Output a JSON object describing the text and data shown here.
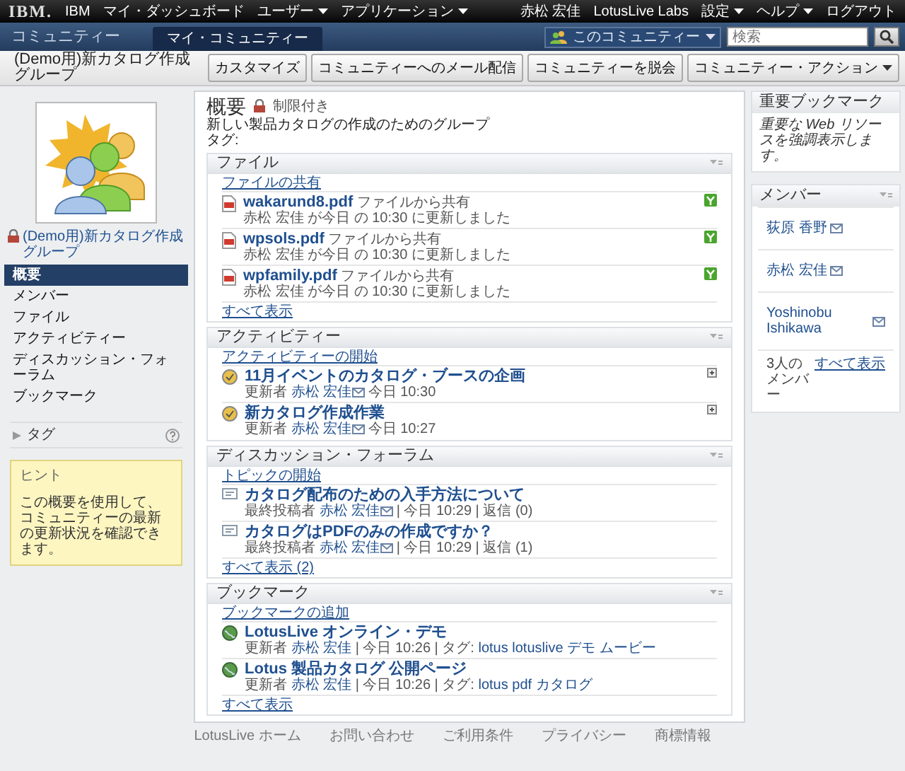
{
  "top_bar": {
    "logo": "IBM.",
    "left_items": [
      {
        "label": "IBM",
        "has_menu": false
      },
      {
        "label": "マイ・ダッシュボード",
        "has_menu": false
      },
      {
        "label": "ユーザー",
        "has_menu": true
      },
      {
        "label": "アプリケーション",
        "has_menu": true
      }
    ],
    "right_items": [
      {
        "label": "赤松 宏佳",
        "has_menu": false
      },
      {
        "label": "LotusLive Labs",
        "has_menu": false
      },
      {
        "label": "設定",
        "has_menu": true
      },
      {
        "label": "ヘルプ",
        "has_menu": true
      },
      {
        "label": "ログアウト",
        "has_menu": false
      }
    ]
  },
  "nav_bar": {
    "title": "コミュニティー",
    "tabs": [
      {
        "label": "マイ・コミュニティー",
        "selected": true
      }
    ],
    "scope": "このコミュニティー",
    "search": {
      "placeholder": "検索"
    }
  },
  "title_bar": {
    "title": "(Demo用)新カタログ作成グループ",
    "buttons": [
      {
        "label": "カスタマイズ",
        "has_menu": false
      },
      {
        "label": "コミュニティーへのメール配信",
        "has_menu": false
      },
      {
        "label": "コミュニティーを脱会",
        "has_menu": false
      },
      {
        "label": "コミュニティー・アクション",
        "has_menu": true
      }
    ]
  },
  "sidebar": {
    "community_name": "(Demo用)新カタログ作成グループ",
    "items": [
      {
        "label": "概要",
        "selected": true
      },
      {
        "label": "メンバー",
        "selected": false
      },
      {
        "label": "ファイル",
        "selected": false
      },
      {
        "label": "アクティビティー",
        "selected": false
      },
      {
        "label": "ディスカッション・フォーラム",
        "selected": false
      },
      {
        "label": "ブックマーク",
        "selected": false
      }
    ],
    "tags": {
      "label": "タグ",
      "expanded": false
    },
    "hint": {
      "title": "ヒント",
      "text": "この概要を使用して、コミュニティーの最新の更新状況を確認できます。"
    }
  },
  "overview": {
    "title": "概要",
    "access": "制限付き",
    "description": "新しい製品カタログの作成のためのグループ",
    "tags_label": "タグ:"
  },
  "widgets": [
    {
      "kind": "files",
      "title": "ファイル",
      "action": "ファイルの共有",
      "items": [
        {
          "name": "wakarund8.pdf",
          "source": "ファイルから共有",
          "meta": "赤松 宏佳 が今日 の 10:30 に更新しました"
        },
        {
          "name": "wpsols.pdf",
          "source": "ファイルから共有",
          "meta": "赤松 宏佳 が今日 の 10:30 に更新しました"
        },
        {
          "name": "wpfamily.pdf",
          "source": "ファイルから共有",
          "meta": "赤松 宏佳 が今日 の 10:30 に更新しました"
        }
      ],
      "view_all": "すべて表示"
    },
    {
      "kind": "activities",
      "title": "アクティビティー",
      "action": "アクティビティーの開始",
      "items": [
        {
          "title": "11月イベントのカタログ・ブースの企画",
          "label": "更新者",
          "author": "赤松 宏佳",
          "time": "今日 10:30"
        },
        {
          "title": "新カタログ作成作業",
          "label": "更新者",
          "author": "赤松 宏佳",
          "time": "今日 10:27"
        }
      ]
    },
    {
      "kind": "forum",
      "title": "ディスカッション・フォーラム",
      "action": "トピックの開始",
      "items": [
        {
          "title": "カタログ配布のための入手方法について",
          "label": "最終投稿者",
          "author": "赤松 宏佳",
          "time": "| 今日 10:29 |",
          "replies": "返信 (0)"
        },
        {
          "title": "カタログはPDFのみの作成ですか？",
          "label": "最終投稿者",
          "author": "赤松 宏佳",
          "time": "| 今日 10:29 |",
          "replies": "返信 (1)"
        }
      ],
      "view_all": "すべて表示 (2)"
    },
    {
      "kind": "bookmarks",
      "title": "ブックマーク",
      "action": "ブックマークの追加",
      "items": [
        {
          "title": "LotusLive オンライン・デモ",
          "label": "更新者",
          "author": "赤松 宏佳",
          "time": "| 今日 10:26 | タグ:",
          "tags": [
            "lotus",
            "lotuslive",
            "デモ",
            "ムービー"
          ]
        },
        {
          "title": "Lotus 製品カタログ 公開ページ",
          "label": "更新者",
          "author": "赤松 宏佳",
          "time": "| 今日 10:26 | タグ:",
          "tags": [
            "lotus",
            "pdf",
            "カタログ"
          ]
        }
      ],
      "view_all": "すべて表示"
    }
  ],
  "important_bookmarks": {
    "title": "重要ブックマーク",
    "text": "重要な Web リソースを強調表示します。"
  },
  "members": {
    "title": "メンバー",
    "items": [
      "荻原 香野",
      "赤松 宏佳",
      "Yoshinobu Ishikawa"
    ],
    "count": "3人のメンバー",
    "view_all": "すべて表示"
  },
  "footer": {
    "links": [
      "LotusLive ホーム",
      "お問い合わせ",
      "ご利用条件",
      "プライバシー",
      "商標情報"
    ]
  }
}
